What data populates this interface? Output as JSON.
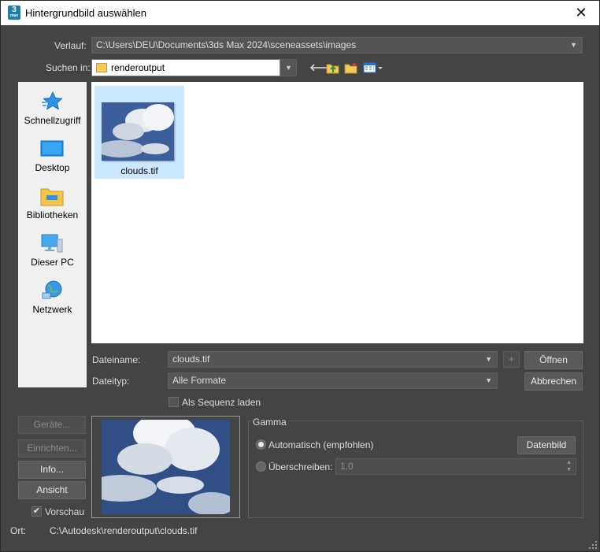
{
  "window": {
    "title": "Hintergrundbild auswählen",
    "app_icon_label": "3",
    "close_symbol": "✕"
  },
  "history": {
    "label": "Verlauf:",
    "value": "C:\\Users\\DEU\\Documents\\3ds Max 2024\\sceneassets\\images"
  },
  "lookin": {
    "label": "Suchen in:",
    "value": "renderoutput"
  },
  "toolbar": {
    "back_icon": "back-arrow-icon",
    "up_icon": "up-folder-icon",
    "new_folder_icon": "new-folder-icon",
    "view_icon": "view-menu-icon"
  },
  "places": [
    {
      "label": "Schnellzugriff",
      "icon": "star-icon"
    },
    {
      "label": "Desktop",
      "icon": "desktop-icon"
    },
    {
      "label": "Bibliotheken",
      "icon": "libraries-icon"
    },
    {
      "label": "Dieser PC",
      "icon": "computer-icon"
    },
    {
      "label": "Netzwerk",
      "icon": "network-icon"
    }
  ],
  "files": [
    {
      "name": "clouds.tif",
      "selected": true
    }
  ],
  "filename": {
    "label": "Dateiname:",
    "value": "clouds.tif",
    "plus_label": "+"
  },
  "filetype": {
    "label": "Dateityp:",
    "value": "Alle Formate"
  },
  "buttons": {
    "open": "Öffnen",
    "cancel": "Abbrechen",
    "devices": "Geräte...",
    "setup": "Einrichten...",
    "info": "Info...",
    "view": "Ansicht",
    "datenbild": "Datenbild"
  },
  "sequence": {
    "label": "Als Sequenz laden",
    "checked": false
  },
  "preview": {
    "label": "Vorschau",
    "checked": true
  },
  "gamma": {
    "title": "Gamma",
    "auto_label": "Automatisch (empfohlen)",
    "override_label": "Überschreiben:",
    "override_value": "1,0",
    "selected": "auto"
  },
  "location": {
    "label": "Ort:",
    "value": "C:\\Autodesk\\renderoutput\\clouds.tif"
  },
  "colors": {
    "dialog_bg": "#444444",
    "selection": "#cce8ff",
    "accent_blue": "#1e90ff"
  }
}
